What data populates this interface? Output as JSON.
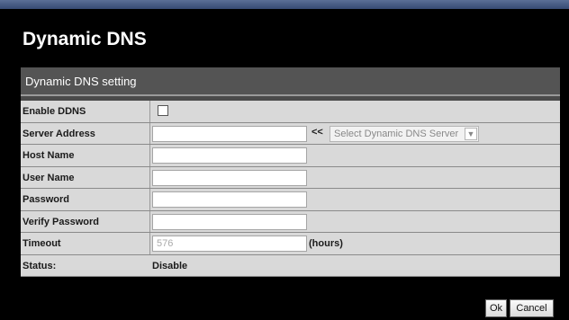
{
  "page": {
    "title": "Dynamic DNS"
  },
  "section": {
    "title": "Dynamic DNS setting"
  },
  "form": {
    "enable_ddns_label": "Enable DDNS",
    "server_address_label": "Server Address",
    "server_address_value": "",
    "server_arrows": "<<",
    "server_select": "Select Dynamic DNS Server",
    "host_name_label": "Host Name",
    "host_name_value": "",
    "user_name_label": "User Name",
    "user_name_value": "",
    "password_label": "Password",
    "password_value": "",
    "verify_password_label": "Verify Password",
    "verify_password_value": "",
    "timeout_label": "Timeout",
    "timeout_value": "576",
    "timeout_unit": "(hours)",
    "status_label": "Status:",
    "status_value": "Disable"
  },
  "buttons": {
    "ok": "Ok",
    "cancel": "Cancel"
  },
  "icons": {
    "select_chevron": "chevron-down-icon"
  },
  "colors": {
    "background": "#000000",
    "row_bg": "#d9d9d9",
    "section_header_bg": "#545454"
  }
}
